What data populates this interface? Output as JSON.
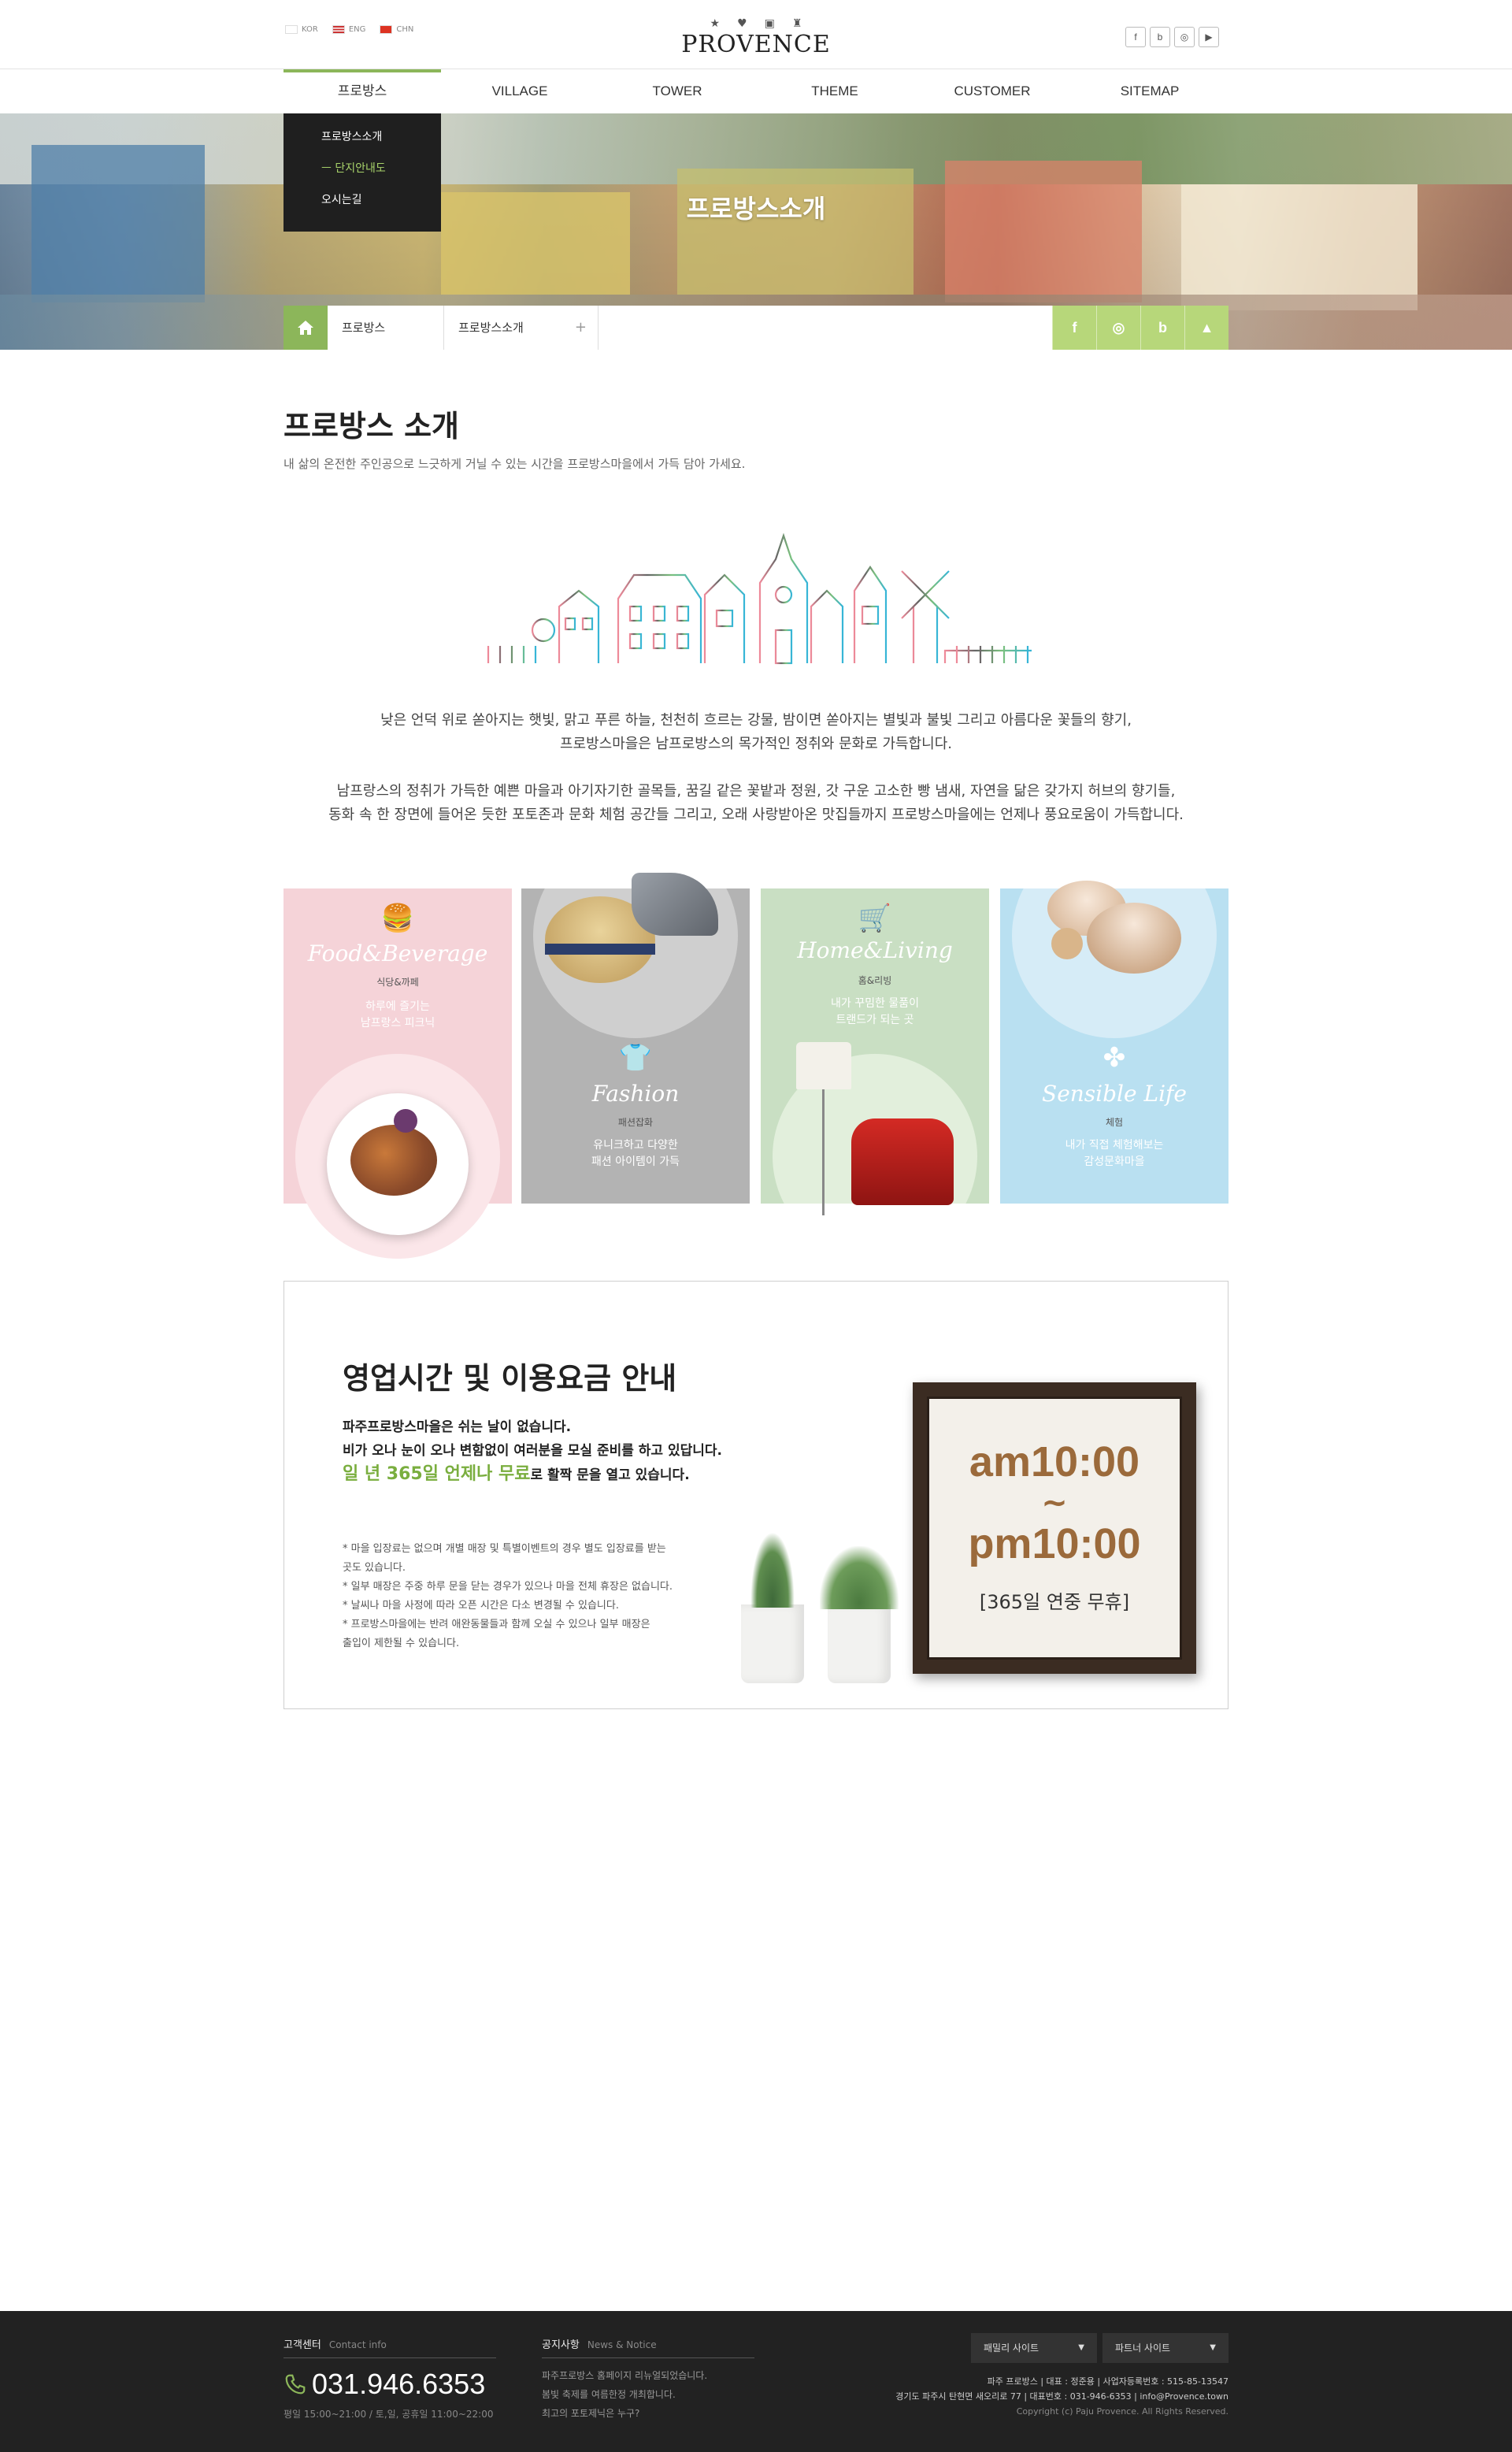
{
  "header": {
    "languages": [
      "KOR",
      "ENG",
      "CHN"
    ],
    "logo": "PROVENCE",
    "logo_icons": [
      "star-icon",
      "heart-icon",
      "bag-icon",
      "cup-icon"
    ],
    "sns": [
      "f",
      "b",
      "◎",
      "▶"
    ]
  },
  "nav": {
    "items": [
      "프로방스",
      "VILLAGE",
      "TOWER",
      "THEME",
      "CUSTOMER",
      "SITEMAP"
    ],
    "active_index": 0,
    "accent_color": "#8cb65a"
  },
  "submenu": {
    "items": [
      "프로방스소개",
      "ㅡ 단지안내도",
      "오시는길"
    ],
    "active_index": 1
  },
  "hero": {
    "title": "프로방스소개"
  },
  "location": {
    "crumbs": [
      "프로방스",
      "프로방스소개"
    ],
    "plus": "+",
    "sns": [
      "f",
      "◎",
      "b",
      "▲"
    ]
  },
  "intro": {
    "title": "프로방스 소개",
    "subtitle": "내 삶의 온전한 주인공으로 느긋하게 거닐 수 있는 시간을 프로방스마을에서 가득 담아 가세요.",
    "paragraph1_line1": "낮은 언덕 위로 쏟아지는 햇빛, 맑고 푸른 하늘, 천천히 흐르는 강물, 밤이면 쏟아지는 별빛과 불빛 그리고 아름다운 꽃들의 향기,",
    "paragraph1_line2": "프로방스마을은 남프로방스의 목가적인 정취와 문화로 가득합니다.",
    "paragraph2_line1": "남프랑스의 정취가 가득한 예쁜 마을과 아기자기한 골목들, 꿈길 같은 꽃밭과 정원, 갓 구운 고소한 빵 냄새, 자연을 닮은 갖가지 허브의 향기들,",
    "paragraph2_line2": "동화 속 한 장면에 들어온 듯한 포토존과 문화 체험 공간들 그리고, 오래 사랑받아온 맛집들까지 프로방스마을에는 언제나 풍요로움이 가득합니다."
  },
  "categories": [
    {
      "title": "Food&Beverage",
      "ko": "식당&까페",
      "desc1": "하루에 즐기는",
      "desc2": "남프랑스 피크닉",
      "icon": "burger-icon",
      "color": "#f5d3d8"
    },
    {
      "title": "Fashion",
      "ko": "패션잡화",
      "desc1": "유니크하고 다양한",
      "desc2": "패션 아이템이 가득",
      "icon": "tshirt-icon",
      "color": "#b3b3b3"
    },
    {
      "title": "Home&Living",
      "ko": "홈&리빙",
      "desc1": "내가 꾸밈한 물품이",
      "desc2": "트랜드가 되는 곳",
      "icon": "cart-icon",
      "color": "#c9dfc3"
    },
    {
      "title": "Sensible Life",
      "ko": "체험",
      "desc1": "내가 직접 체험해보는",
      "desc2": "감성문화마을",
      "icon": "clover-icon",
      "color": "#b9e0f1"
    }
  ],
  "hours": {
    "title": "영업시간 및 이용요금 안내",
    "line1": "파주프로방스마을은 쉬는 날이 없습니다.",
    "line2": "비가 오나 눈이 오나 변함없이 여러분을 모실 준비를 하고 있답니다.",
    "line3_green": "일 년 365일 언제나 무료",
    "line3_rest": "로 활짝 문을 열고 있습니다.",
    "notes": [
      "* 마을 입장료는 없으며 개별 매장 및 특별이벤트의 경우 별도 입장료를 받는",
      "   곳도 있습니다.",
      "* 일부 매장은 주중 하루 문을 닫는 경우가 있으나 마을 전체 휴장은 없습니다.",
      "* 날씨나 마을 사정에 따라 오픈 시간은 다소 변경될 수 있습니다.",
      "* 프로방스마을에는 반려 애완동물들과 함께 오실 수 있으나 일부 매장은",
      "   출입이 제한될 수 있습니다."
    ],
    "open": "am10:00",
    "tilde": "~",
    "close": "pm10:00",
    "closed_note": "[365일 연중 무휴]",
    "time_color": "#9b6a3b"
  },
  "footer": {
    "contact_head": "고객센터",
    "contact_head_en": "Contact info",
    "phone": "031.946.6353",
    "hours": "평일 15:00~21:00 / 토,일, 공휴일 11:00~22:00",
    "notice_head": "공지사항",
    "notice_head_en": "News & Notice",
    "notices": [
      "파주프로방스 홈페이지 리뉴얼되었습니다.",
      "봄빛 축제를 여름한정 개최합니다.",
      "최고의 포토제닉은 누구?"
    ],
    "family_site": "패밀리 사이트",
    "partner_site": "파트너 사이트",
    "info_line1": "파주 프로방스   |   대표 : 정준용   |   사업자등록번호 : 515-85-13547",
    "info_line2": "경기도 파주시 탄현면 새오리로 77   |   대표번호 : 031-946-6353   |   info@Provence.town",
    "copyright": "Copyright (c) Paju Provence. All Rights Reserved."
  }
}
